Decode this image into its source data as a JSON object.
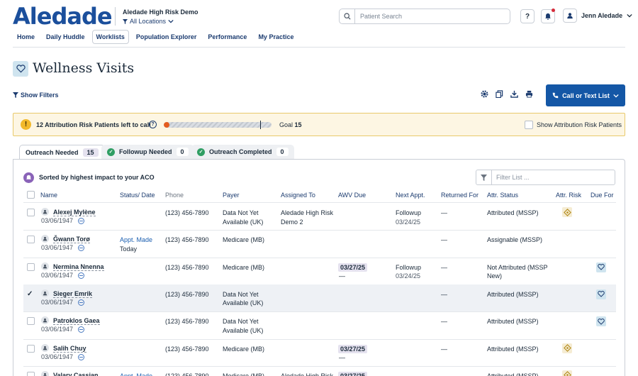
{
  "header": {
    "logo": "Aledade",
    "org": "Aledade High Risk Demo",
    "location": "All Locations",
    "search_placeholder": "Patient Search",
    "help": "?",
    "user": "Jenn Aledade"
  },
  "nav": [
    "Home",
    "Daily Huddle",
    "Worklists",
    "Population Explorer",
    "Performance",
    "My Practice"
  ],
  "page": {
    "title": "Wellness Visits",
    "show_filters": "Show Filters",
    "call_button": "Call or Text List"
  },
  "banner": {
    "text": "12 Attribution Risk Patients left to call",
    "progress": 0.05,
    "goal_label": "Goal",
    "goal_value": "15",
    "checkbox_label": "Show Attribution Risk Patients"
  },
  "tabs": [
    {
      "label": "Outreach Needed",
      "count": "15"
    },
    {
      "label": "Followup Needed",
      "count": "0"
    },
    {
      "label": "Outreach Completed",
      "count": "0"
    }
  ],
  "sort_text": "Sorted by highest impact to your ACO",
  "filter_placeholder": "Filter List ...",
  "columns": [
    "Name",
    "Status/ Date",
    "Phone",
    "Payer",
    "Assigned To",
    "AWV Due",
    "Next Appt.",
    "Returned For",
    "Attr. Status",
    "Attr. Risk",
    "Due For"
  ],
  "rows": [
    {
      "name": "Alexej Mylène",
      "dob": "03/06/1947",
      "status": "",
      "status_date": "",
      "phone": "(123) 456-7890",
      "payer": "Data Not Yet Available (UK)",
      "assigned": "Aledade High Risk Demo 2",
      "awv": "",
      "awv_sub": "",
      "next": "Followup",
      "next_date": "03/24/25",
      "returned": "—",
      "attr": "Attributed (MSSP)",
      "risk": true,
      "due": false
    },
    {
      "name": "Ǧwann Torø",
      "dob": "03/06/1947",
      "status": "Appt. Made",
      "status_date": "Today",
      "phone": "(123) 456-7890",
      "payer": "Medicare (MB)",
      "assigned": "",
      "awv": "",
      "awv_sub": "",
      "next": "",
      "next_date": "",
      "returned": "—",
      "attr": "Assignable (MSSP)",
      "risk": false,
      "due": false
    },
    {
      "name": "Nermina Nnenna",
      "dob": "03/06/1947",
      "status": "",
      "status_date": "",
      "phone": "(123) 456-7890",
      "payer": "Medicare (MB)",
      "assigned": "",
      "awv": "03/27/25",
      "awv_sub": "—",
      "next": "Followup",
      "next_date": "03/24/25",
      "returned": "—",
      "attr": "Not Attributed (MSSP New)",
      "risk": false,
      "due": true
    },
    {
      "name": "Sieger Emrik",
      "dob": "03/06/1947",
      "status": "",
      "status_date": "",
      "phone": "(123) 456-7890",
      "payer": "Data Not Yet Available (UK)",
      "assigned": "",
      "awv": "",
      "awv_sub": "",
      "next": "",
      "next_date": "",
      "returned": "—",
      "attr": "Attributed (MSSP)",
      "risk": false,
      "due": true
    },
    {
      "name": "Patroklos Gaea",
      "dob": "03/06/1947",
      "status": "",
      "status_date": "",
      "phone": "(123) 456-7890",
      "payer": "Data Not Yet Available (UK)",
      "assigned": "",
      "awv": "",
      "awv_sub": "",
      "next": "",
      "next_date": "",
      "returned": "—",
      "attr": "Attributed (MSSP)",
      "risk": false,
      "due": true
    },
    {
      "name": "Salih Chuy",
      "dob": "03/06/1947",
      "status": "",
      "status_date": "",
      "phone": "(123) 456-7890",
      "payer": "Medicare (MB)",
      "assigned": "",
      "awv": "03/27/25",
      "awv_sub": "—",
      "next": "",
      "next_date": "",
      "returned": "—",
      "attr": "Attributed (MSSP)",
      "risk": true,
      "due": false
    },
    {
      "name": "Valary Cassian",
      "dob": "",
      "status": "Appt. Made",
      "status_date": "",
      "phone": "(123) 456-7890",
      "payer": "Medicare (MB)",
      "assigned": "Aledade High Risk",
      "awv": "03/27/25",
      "awv_sub": "",
      "next": "",
      "next_date": "",
      "returned": "—",
      "attr": "Attributed (MSSP)",
      "risk": true,
      "due": false
    }
  ],
  "selected_row": 3,
  "colors": {
    "primary": "#1457a6",
    "navy": "#1b3b6f",
    "progress": "#e45c1f",
    "warn": "#f2b92b"
  }
}
